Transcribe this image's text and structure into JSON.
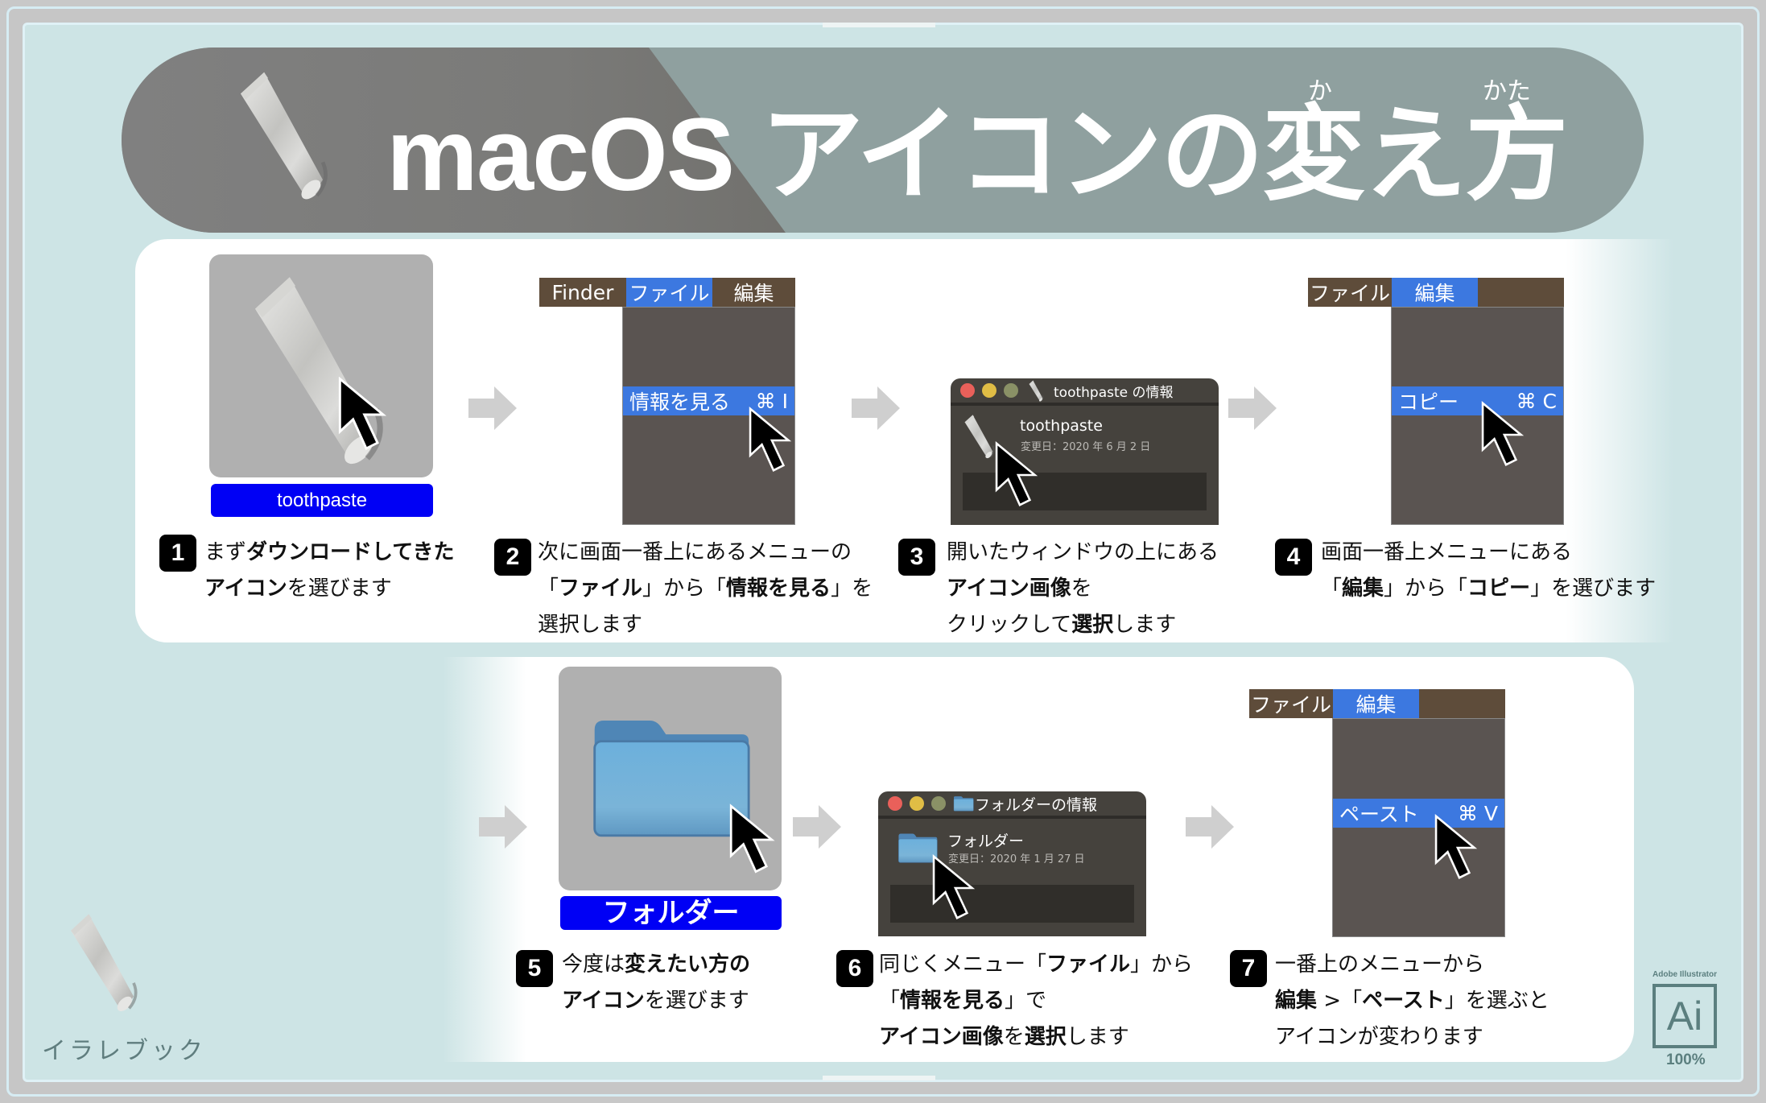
{
  "title": {
    "main": "macOS アイコンの変え方",
    "ruby_ka": "か",
    "ruby_kata": "かた"
  },
  "steps": [
    {
      "number": "1",
      "text_html_parts": [
        {
          "t": "まず",
          "b": false
        },
        {
          "t": "ダウンロードしてきた",
          "b": true
        },
        {
          "br": true
        },
        {
          "t": "アイコン",
          "b": true
        },
        {
          "t": "を選びます",
          "b": false
        }
      ],
      "icon_label": "toothpaste"
    },
    {
      "number": "2",
      "text_html_parts": [
        {
          "t": "次に画面一番上にあるメニューの",
          "b": false
        },
        {
          "br": true
        },
        {
          "t": "「",
          "b": false
        },
        {
          "t": "ファイル",
          "b": true
        },
        {
          "t": "」から「",
          "b": false
        },
        {
          "t": "情報を見る",
          "b": true
        },
        {
          "t": "」を",
          "b": false
        },
        {
          "br": true
        },
        {
          "t": "選択します",
          "b": false
        }
      ],
      "menubar": [
        "Finder",
        "ファイル",
        "編集"
      ],
      "menubar_highlight": 1,
      "menu_item": "情報を見る",
      "shortcut": "⌘ I"
    },
    {
      "number": "3",
      "text_html_parts": [
        {
          "t": "開いたウィンドウの上にある",
          "b": false
        },
        {
          "br": true
        },
        {
          "t": "アイコン画像",
          "b": true
        },
        {
          "t": "を",
          "b": false
        },
        {
          "br": true
        },
        {
          "t": "クリックして",
          "b": false
        },
        {
          "t": "選択",
          "b": true
        },
        {
          "t": "します",
          "b": false
        }
      ],
      "window_title": "toothpaste の情報",
      "item_name": "toothpaste",
      "modified": "変更日：2020 年 6 月 2 日"
    },
    {
      "number": "4",
      "text_html_parts": [
        {
          "t": "画面一番上メニューにある",
          "b": false
        },
        {
          "br": true
        },
        {
          "t": "「",
          "b": false
        },
        {
          "t": "編集",
          "b": true
        },
        {
          "t": "」から「",
          "b": false
        },
        {
          "t": "コピー",
          "b": true
        },
        {
          "t": "」を選びます",
          "b": false
        }
      ],
      "menubar": [
        "ファイル",
        "編集",
        ""
      ],
      "menubar_highlight": 1,
      "menu_item": "コピー",
      "shortcut": "⌘ C"
    },
    {
      "number": "5",
      "text_html_parts": [
        {
          "t": "今度は",
          "b": false
        },
        {
          "t": "変えたい方の",
          "b": true
        },
        {
          "br": true
        },
        {
          "t": "アイコン",
          "b": true
        },
        {
          "t": "を選びます",
          "b": false
        }
      ],
      "icon_label": "フォルダー"
    },
    {
      "number": "6",
      "text_html_parts": [
        {
          "t": "同じくメニュー「",
          "b": false
        },
        {
          "t": "ファイル",
          "b": true
        },
        {
          "t": "」から",
          "b": false
        },
        {
          "br": true
        },
        {
          "t": "「",
          "b": false
        },
        {
          "t": "情報を見る",
          "b": true
        },
        {
          "t": "」で",
          "b": false
        },
        {
          "br": true
        },
        {
          "t": "アイコン画像",
          "b": true
        },
        {
          "t": "を",
          "b": false
        },
        {
          "t": "選択",
          "b": true
        },
        {
          "t": "します",
          "b": false
        }
      ],
      "window_title": "フォルダーの情報",
      "item_name": "フォルダー",
      "modified": "変更日：2020 年 1 月 27 日"
    },
    {
      "number": "7",
      "text_html_parts": [
        {
          "t": "一番上のメニューから",
          "b": false
        },
        {
          "br": true
        },
        {
          "t": "編集",
          "b": true
        },
        {
          "t": " >「",
          "b": false
        },
        {
          "t": "ペースト",
          "b": true
        },
        {
          "t": "」を選ぶと",
          "b": false
        },
        {
          "br": true
        },
        {
          "t": "アイコンが変わります",
          "b": false
        }
      ],
      "menubar": [
        "ファイル",
        "編集",
        ""
      ],
      "menubar_highlight": 1,
      "menu_item": "ペースト",
      "shortcut": "⌘ V"
    }
  ],
  "watermark": "イラレブック",
  "app_badge": {
    "caption": "Adobe Illustrator",
    "logo": "Ai",
    "zoom": "100%"
  },
  "colors": {
    "panel_bg": "#cde4e5",
    "menu_highlight": "#3c78e0",
    "menubar_bg": "#5e4c3a",
    "menu_bg": "#5a5451",
    "label_bg": "#0000f5",
    "traffic_red": "#e9605a",
    "traffic_yellow": "#e0bd45",
    "traffic_green": "#8a9166"
  }
}
